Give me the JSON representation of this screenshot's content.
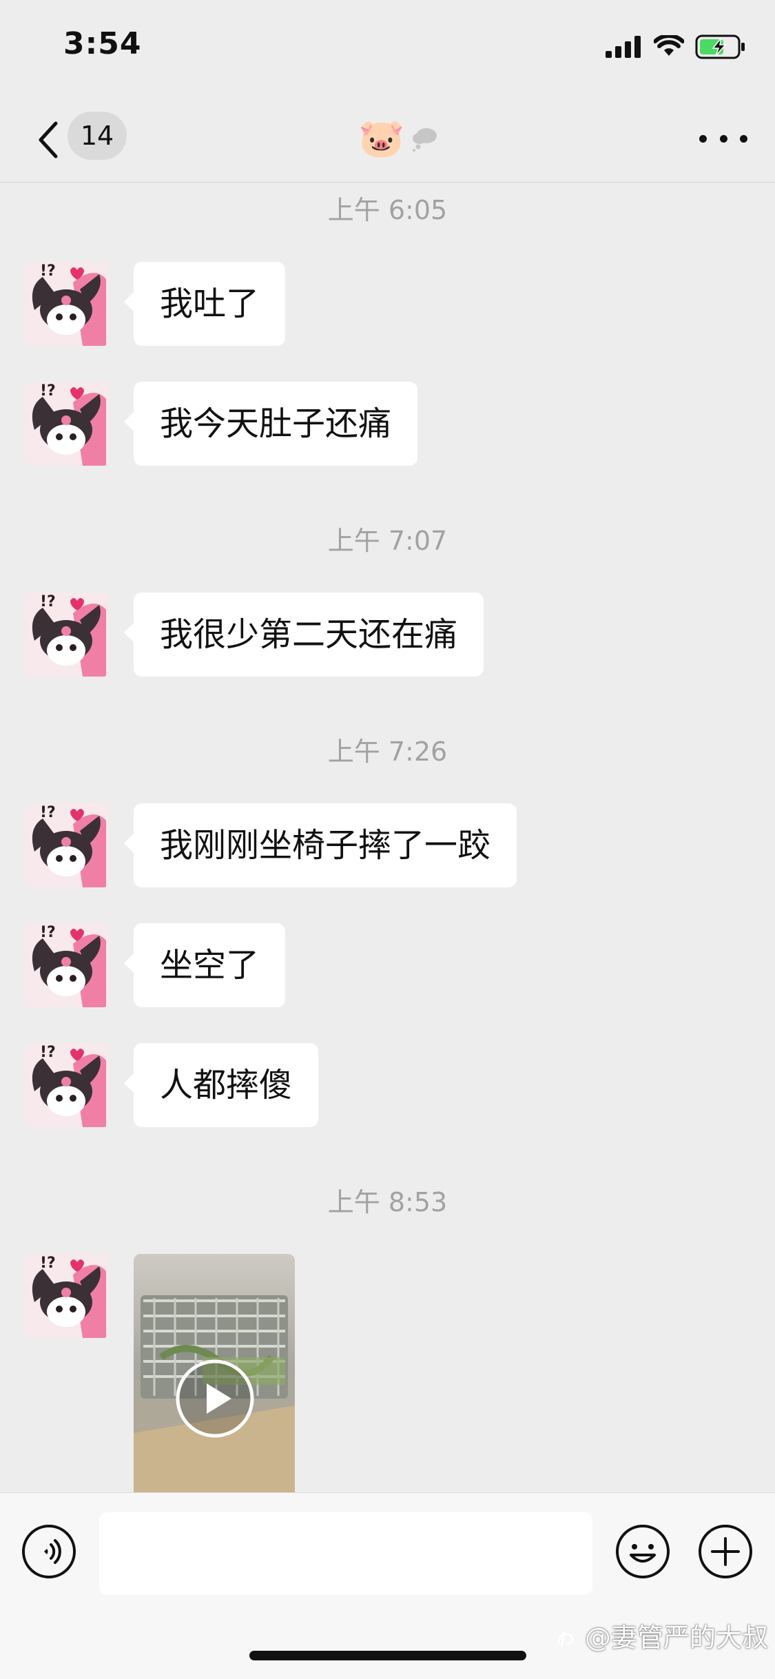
{
  "status_bar": {
    "time": "3:54"
  },
  "nav": {
    "unread_count": "14",
    "title_emoji": "🐷",
    "title_icon": "cloud-icon",
    "more_icon": "more-dots-icon"
  },
  "messages": [
    {
      "type": "time",
      "text": "上午 6:05"
    },
    {
      "type": "text",
      "text": "我吐了"
    },
    {
      "type": "text",
      "text": "我今天肚子还痛"
    },
    {
      "type": "time",
      "text": "上午 7:07"
    },
    {
      "type": "text",
      "text": "我很少第二天还在痛"
    },
    {
      "type": "time",
      "text": "上午 7:26"
    },
    {
      "type": "text",
      "text": "我刚刚坐椅子摔了一跤"
    },
    {
      "type": "text",
      "text": "坐空了"
    },
    {
      "type": "text",
      "text": "人都摔傻"
    },
    {
      "type": "time",
      "text": "上午 8:53"
    },
    {
      "type": "video"
    }
  ],
  "input_bar": {
    "text_value": "",
    "voice_icon": "voice-icon",
    "emoji_icon": "emoji-icon",
    "plus_icon": "plus-icon"
  },
  "watermark": "@妻管严的大叔",
  "colors": {
    "background": "#EDEDED",
    "bubble": "#FFFFFF",
    "timestamp": "#A2A2A2",
    "battery": "#4CD964",
    "badge": "#DADADA"
  }
}
